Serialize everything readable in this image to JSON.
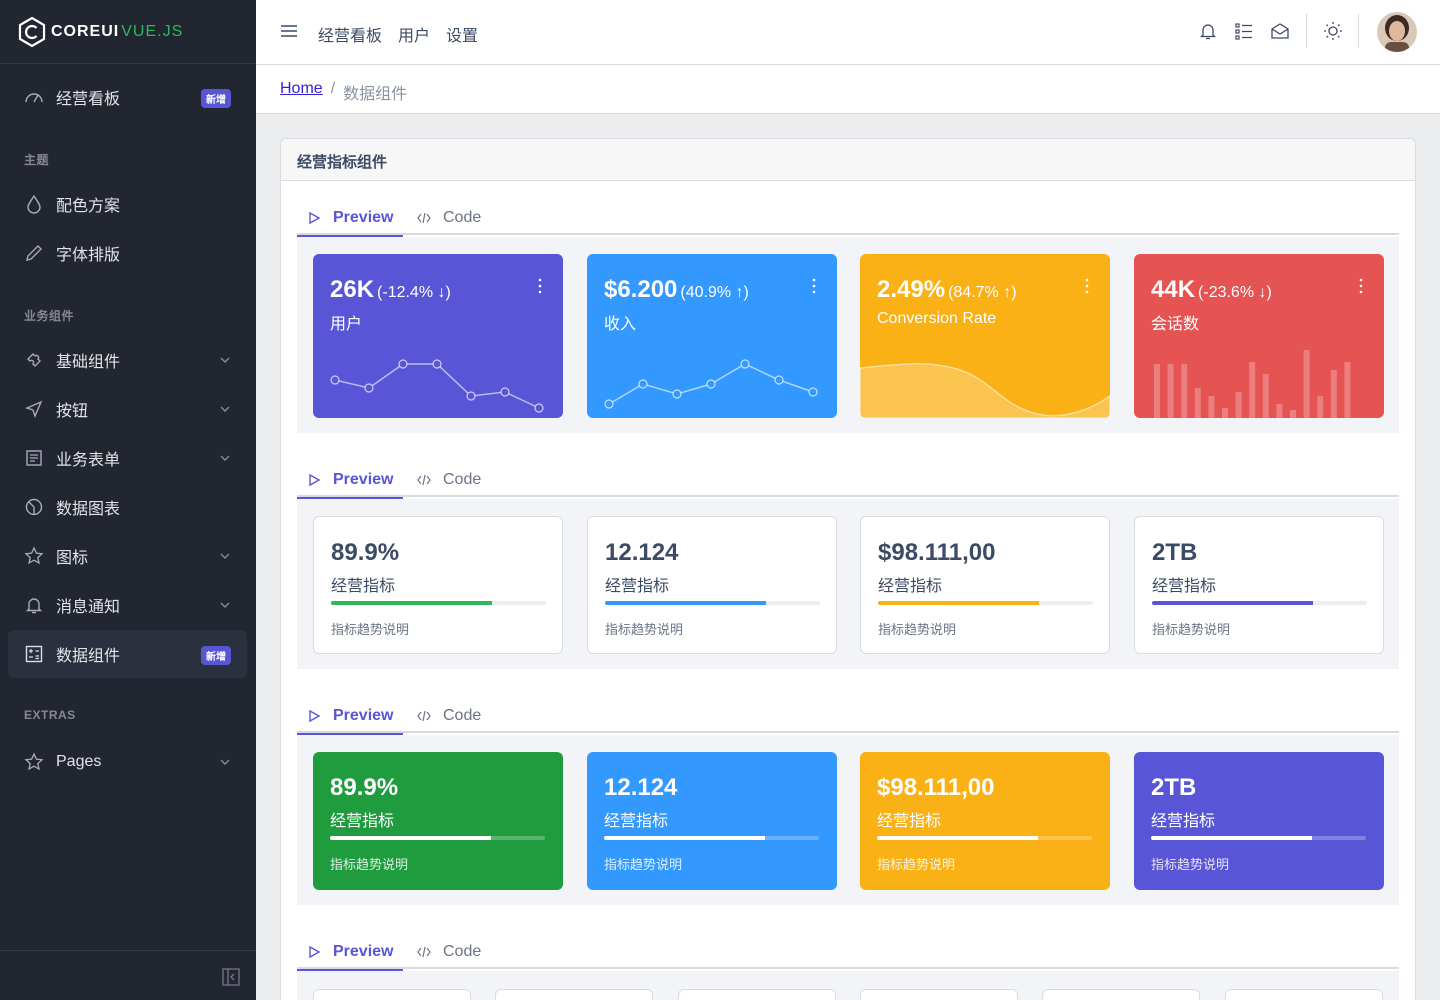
{
  "brand": {
    "name": "COREUI",
    "suffix": "VUE.JS"
  },
  "sidebar": {
    "items": [
      {
        "label": "经营看板",
        "badge": "新增",
        "icon": "speedometer-icon"
      },
      {
        "label": "配色方案",
        "icon": "drop-icon"
      },
      {
        "label": "字体排版",
        "icon": "pencil-icon"
      },
      {
        "label": "基础组件",
        "icon": "puzzle-icon"
      },
      {
        "label": "按钮",
        "icon": "cursor-icon"
      },
      {
        "label": "业务表单",
        "icon": "notes-icon"
      },
      {
        "label": "数据图表",
        "icon": "chart-pie-icon"
      },
      {
        "label": "图标",
        "icon": "star-icon"
      },
      {
        "label": "消息通知",
        "icon": "bell-icon"
      },
      {
        "label": "数据组件",
        "badge": "新增",
        "icon": "calculator-icon"
      },
      {
        "label": "Pages",
        "icon": "star-icon"
      }
    ],
    "titles": {
      "theme": "主题",
      "components": "业务组件",
      "extras": "EXTRAS"
    }
  },
  "header": {
    "nav": [
      "经营看板",
      "用户",
      "设置"
    ]
  },
  "breadcrumb": {
    "home": "Home",
    "current": "数据组件"
  },
  "card": {
    "title": "经营指标组件"
  },
  "tabs": {
    "preview": "Preview",
    "code": "Code"
  },
  "widgets": [
    {
      "value": "26K",
      "change": "(-12.4% ↓)",
      "label": "用户",
      "color": "#5856d6",
      "chart": "line"
    },
    {
      "value": "$6.200",
      "change": "(40.9% ↑)",
      "label": "收入",
      "color": "#3399ff",
      "chart": "line"
    },
    {
      "value": "2.49%",
      "change": "(84.7% ↑)",
      "label": "Conversion Rate",
      "color": "#f9b115",
      "chart": "area"
    },
    {
      "value": "44K",
      "change": "(-23.6% ↓)",
      "label": "会话数",
      "color": "#e55353",
      "chart": "bar"
    }
  ],
  "progress_white": [
    {
      "value": "89.9%",
      "label": "经营指标",
      "note": "指标趋势说明",
      "progress": 0.75,
      "color": "#2eb85c"
    },
    {
      "value": "12.124",
      "label": "经营指标",
      "note": "指标趋势说明",
      "progress": 0.75,
      "color": "#3399ff"
    },
    {
      "value": "$98.111,00",
      "label": "经营指标",
      "note": "指标趋势说明",
      "progress": 0.75,
      "color": "#f9b115"
    },
    {
      "value": "2TB",
      "label": "经营指标",
      "note": "指标趋势说明",
      "progress": 0.75,
      "color": "#5856d6"
    }
  ],
  "progress_filled": [
    {
      "value": "89.9%",
      "label": "经营指标",
      "note": "指标趋势说明",
      "progress": 0.75,
      "color": "#1f9d3e"
    },
    {
      "value": "12.124",
      "label": "经营指标",
      "note": "指标趋势说明",
      "progress": 0.75,
      "color": "#3399ff"
    },
    {
      "value": "$98.111,00",
      "label": "经营指标",
      "note": "指标趋势说明",
      "progress": 0.75,
      "color": "#f9b115"
    },
    {
      "value": "2TB",
      "label": "经营指标",
      "note": "指标趋势说明",
      "progress": 0.75,
      "color": "#5856d6"
    }
  ]
}
